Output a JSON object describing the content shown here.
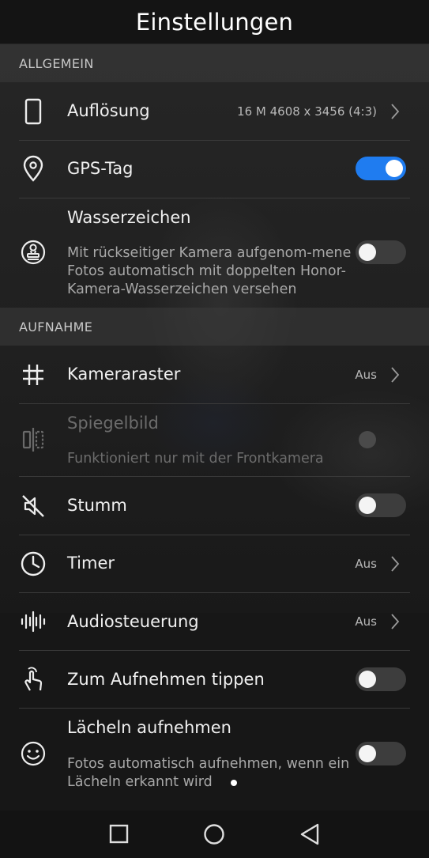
{
  "header": {
    "title": "Einstellungen"
  },
  "sections": {
    "general": "ALLGEMEIN",
    "capture": "AUFNAHME"
  },
  "settings": {
    "resolution": {
      "label": "Auflösung",
      "value": "16 M 4608 x 3456 (4:3)",
      "icon": "phone-outline-icon"
    },
    "gps": {
      "label": "GPS-Tag",
      "enabled": true,
      "icon": "location-pin-icon"
    },
    "watermark": {
      "label": "Wasserzeichen",
      "description": "Mit rückseitiger Kamera aufgenom-mene Fotos automatisch mit doppelten Honor-Kamera-Wasserzeichen versehen",
      "enabled": false,
      "icon": "stamp-icon"
    },
    "grid": {
      "label": "Kameraraster",
      "value": "Aus",
      "icon": "grid-hash-icon"
    },
    "mirror": {
      "label": "Spiegelbild",
      "description": "Funktioniert nur mit der Frontkamera",
      "enabled": false,
      "disabled": true,
      "icon": "mirror-icon"
    },
    "mute": {
      "label": "Stumm",
      "enabled": false,
      "icon": "mute-speaker-icon"
    },
    "timer": {
      "label": "Timer",
      "value": "Aus",
      "icon": "clock-icon"
    },
    "audio": {
      "label": "Audiosteuerung",
      "value": "Aus",
      "icon": "sound-wave-icon"
    },
    "tap": {
      "label": "Zum Aufnehmen tippen",
      "enabled": false,
      "icon": "touch-hand-icon"
    },
    "smile": {
      "label": "Lächeln aufnehmen",
      "description": "Fotos automatisch aufnehmen, wenn ein Lächeln erkannt wird",
      "enabled": false,
      "icon": "smiley-icon"
    }
  },
  "navigation": {
    "recents": "square-recents-icon",
    "home": "circle-home-icon",
    "back": "triangle-back-icon"
  },
  "colors": {
    "accent": "#1f7cf0",
    "background": "#171717",
    "section": "#3c3c3c"
  }
}
